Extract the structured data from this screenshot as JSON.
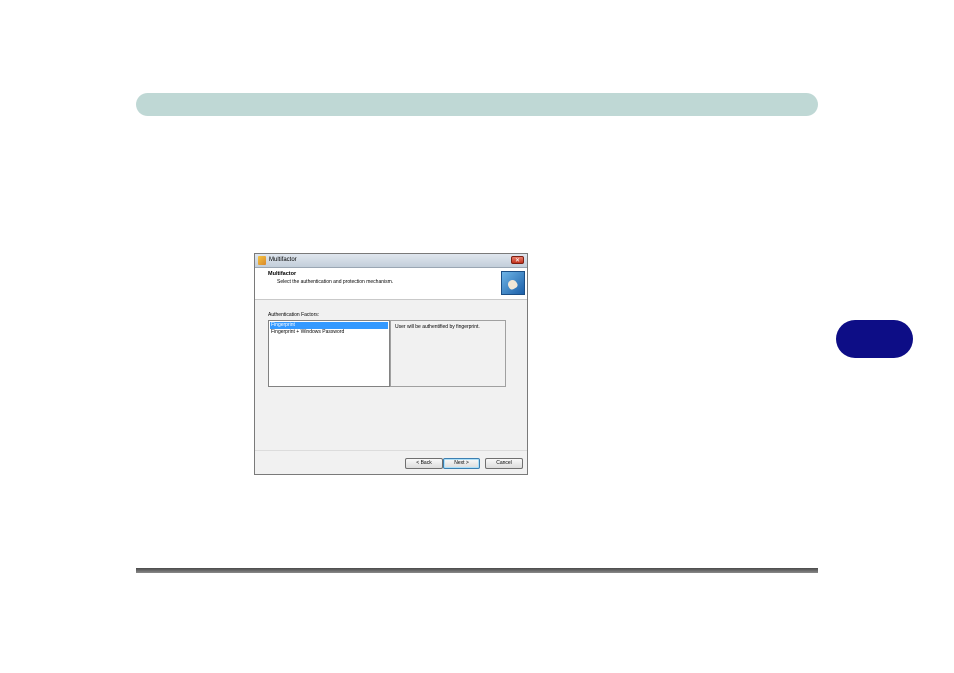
{
  "dialog": {
    "title": "Multifactor",
    "close_glyph": "✕",
    "banner_title": "Multifactor",
    "banner_subtitle": "Select the authentication and protection mechanism.",
    "banner_icon": "fingerprint-reader-icon",
    "factors_label": "Authentication Factors:",
    "factors": [
      {
        "label": "Fingerprint",
        "selected": true
      },
      {
        "label": "Fingerprint + Windows Password",
        "selected": false
      }
    ],
    "description": "User will be authentified by fingerprint.",
    "buttons": {
      "back": "< Back",
      "next": "Next >",
      "cancel": "Cancel"
    }
  },
  "colors": {
    "header_bar": "#bfd8d5",
    "chapter_tab": "#0d0d86",
    "selection": "#3399ff"
  }
}
